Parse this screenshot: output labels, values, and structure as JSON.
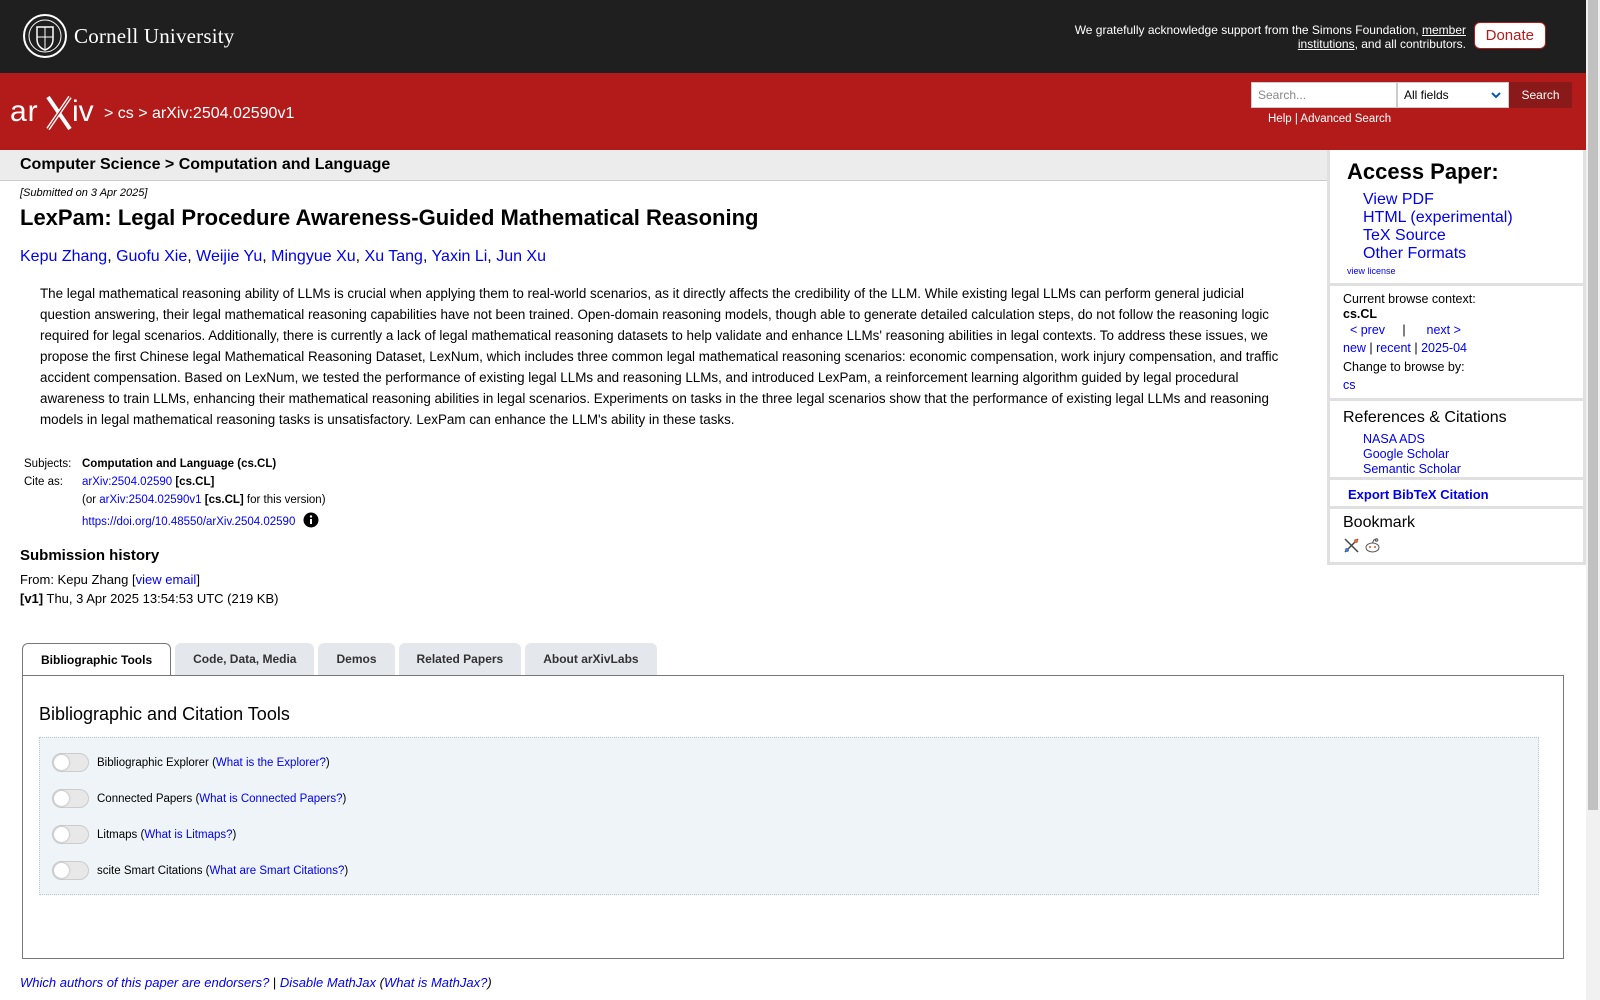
{
  "top": {
    "cornell_name": "Cornell University",
    "ack_pre": "We gratefully acknowledge support from the Simons Foundation, ",
    "ack_link1": "member",
    "ack_link2": "institutions",
    "ack_post": ", and all contributors.",
    "donate": "Donate"
  },
  "header": {
    "crumbs": [
      "> cs > arXiv:2504.02590v1"
    ],
    "search_placeholder": "Search...",
    "search_field": "All fields",
    "search_button": "Search",
    "help": "Help",
    "sep": " | ",
    "advanced": "Advanced Search"
  },
  "subject_bar": "Computer Science > Computation and Language",
  "paper": {
    "submitted": "[Submitted on 3 Apr 2025]",
    "title": "LexPam: Legal Procedure Awareness-Guided Mathematical Reasoning",
    "authors": [
      "Kepu Zhang",
      "Guofu Xie",
      "Weijie Yu",
      "Mingyue Xu",
      "Xu Tang",
      "Yaxin Li",
      "Jun Xu"
    ],
    "abstract": "The legal mathematical reasoning ability of LLMs is crucial when applying them to real-world scenarios, as it directly affects the credibility of the LLM. While existing legal LLMs can perform general judicial question answering, their legal mathematical reasoning capabilities have not been trained. Open-domain reasoning models, though able to generate detailed calculation steps, do not follow the reasoning logic required for legal scenarios. Additionally, there is currently a lack of legal mathematical reasoning datasets to help validate and enhance LLMs' reasoning abilities in legal contexts. To address these issues, we propose the first Chinese legal Mathematical Reasoning Dataset, LexNum, which includes three common legal mathematical reasoning scenarios: economic compensation, work injury compensation, and traffic accident compensation. Based on LexNum, we tested the performance of existing legal LLMs and reasoning LLMs, and introduced LexPam, a reinforcement learning algorithm guided by legal procedural awareness to train LLMs, enhancing their mathematical reasoning abilities in legal scenarios. Experiments on tasks in the three legal scenarios show that the performance of existing legal LLMs and reasoning models in legal mathematical reasoning tasks is unsatisfactory. LexPam can enhance the LLM's ability in these tasks.",
    "subjects_label": "Subjects:",
    "subjects_value": "Computation and Language (cs.CL)",
    "cite_label": "Cite as:",
    "cite_id": "arXiv:2504.02590",
    "cite_cat": " [cs.CL]",
    "cite_or": "(or ",
    "cite_v1": "arXiv:2504.02590v1",
    "cite_v1_cat": " [cs.CL]",
    "cite_v1_post": " for this version)",
    "doi": "https://doi.org/10.48550/arXiv.2504.02590",
    "history_heading": "Submission history",
    "from_pre": "From: Kepu Zhang [",
    "from_link": "view email",
    "from_post": "]",
    "v1_label": "[v1]",
    "v1_text": " Thu, 3 Apr 2025 13:54:53 UTC (219 KB)"
  },
  "sidebar": {
    "access_title": "Access Paper:",
    "access_links": [
      "View PDF",
      "HTML (experimental)",
      "TeX Source",
      "Other Formats"
    ],
    "view_license": "view license",
    "browse_context_label": "Current browse context:",
    "browse_context": "cs.CL",
    "prev": "< prev",
    "pipe": "|",
    "next": "next >",
    "new": "new",
    "recent": "recent",
    "month": "2025-04",
    "change_browse": "Change to browse by:",
    "cs": "cs",
    "refs_title": "References & Citations",
    "refs": [
      "NASA ADS",
      "Google Scholar",
      "Semantic Scholar"
    ],
    "export_bibtex": "Export BibTeX Citation",
    "bookmark": "Bookmark"
  },
  "tabs": [
    "Bibliographic Tools",
    "Code, Data, Media",
    "Demos",
    "Related Papers",
    "About arXivLabs"
  ],
  "panel": {
    "heading": "Bibliographic and Citation Tools",
    "tools": [
      {
        "name": "Bibliographic Explorer",
        "help": "What is the Explorer?"
      },
      {
        "name": "Connected Papers",
        "help": "What is Connected Papers?"
      },
      {
        "name": "Litmaps",
        "help": "What is Litmaps?"
      },
      {
        "name": "scite Smart Citations",
        "help": "What are Smart Citations?"
      }
    ]
  },
  "footer": {
    "endorsers": "Which authors of this paper are endorsers?",
    "sep": " | ",
    "disable_mathjax": "Disable MathJax",
    "what_mathjax": "What is MathJax?"
  }
}
